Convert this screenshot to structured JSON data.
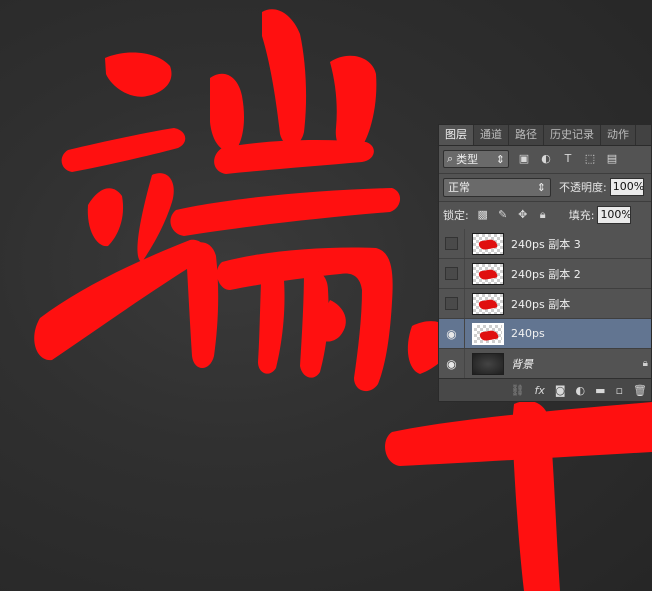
{
  "canvas": {
    "characters": [
      "端",
      "午"
    ],
    "text_color": "#ff1010",
    "background": "#2e2e2e"
  },
  "layers_panel": {
    "tabs": [
      "图层",
      "通道",
      "路径",
      "历史记录",
      "动作"
    ],
    "active_tab": "图层",
    "filter": {
      "label": "类型"
    },
    "filter_icons": [
      "image-filter-icon",
      "adjustment-filter-icon",
      "text-filter-icon",
      "shape-filter-icon",
      "smart-object-filter-icon"
    ],
    "blend_mode": "正常",
    "opacity_label": "不透明度:",
    "opacity_value": "100%",
    "lock_label": "锁定:",
    "lock_icons": [
      "lock-transparent-icon",
      "lock-paint-icon",
      "lock-move-icon",
      "lock-all-icon"
    ],
    "fill_label": "填充:",
    "fill_value": "100%",
    "layers": [
      {
        "name": "240ps 副本 3",
        "visible": false,
        "selected": false
      },
      {
        "name": "240ps 副本 2",
        "visible": false,
        "selected": false
      },
      {
        "name": "240ps 副本",
        "visible": false,
        "selected": false
      },
      {
        "name": "240ps",
        "visible": true,
        "selected": true
      },
      {
        "name": "背景",
        "visible": true,
        "selected": false,
        "locked": true
      }
    ],
    "footer_icons": [
      "link-icon",
      "fx-icon",
      "mask-icon",
      "adjustment-icon",
      "folder-icon",
      "new-layer-icon",
      "trash-icon"
    ],
    "selection_color": "#627591"
  }
}
